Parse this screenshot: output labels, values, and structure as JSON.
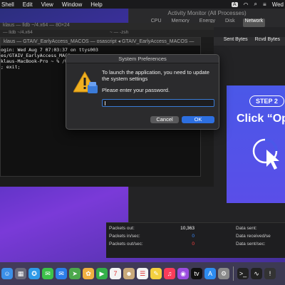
{
  "menubar": {
    "items": [
      "Shell",
      "Edit",
      "View",
      "Window",
      "Help"
    ],
    "right_kbd": "A",
    "clock": "Wed"
  },
  "activity_monitor": {
    "title": "Activity Monitor (All Processes)",
    "tabs": [
      "CPU",
      "Memory",
      "Energy",
      "Disk",
      "Network"
    ],
    "active_tab": "Network",
    "columns": [
      "Sent Bytes",
      "Rcvd Bytes"
    ],
    "stats": {
      "packets_out_label": "Packets out:",
      "packets_out_value": "10,363",
      "packets_in_sec_label": "Packets in/sec:",
      "packets_in_sec_value": "0",
      "packets_out_sec_label": "Packets out/sec:",
      "packets_out_sec_value": "0",
      "data_sent_label": "Data sent:",
      "data_received_label": "Data received/se",
      "data_sent_sec_label": "Data sent/sec:"
    }
  },
  "terminal_back": {
    "title": "klaus — lldb ~/4.x64 — 80×24",
    "tabs": [
      "— lldb ~/4.x64",
      "~ — -zsh"
    ]
  },
  "terminal": {
    "title": "klaus — GTAIV_EarlyAccess_MACOS — osascript ◂ GTAIV_EarlyAccess_MACOS —",
    "lines": [
      "ogin: Wed Aug  7 07:03:37 on ttys003",
      "es/GTAIV_EarlyAccess_MACO",
      "klaus-MacBook-Pro ~ % /U",
      "; exit;"
    ]
  },
  "promo": {
    "step": "STEP 2",
    "click": "Click “Op"
  },
  "dialog": {
    "title": "System Preferences",
    "message": "To launch the application, you need to update the system settings",
    "prompt": "Please enter your password.",
    "password_value": "",
    "cancel_label": "Cancel",
    "ok_label": "OK"
  },
  "dock": {
    "items": [
      {
        "name": "finder-icon",
        "glyph": "☺",
        "color": "#3b8fe8"
      },
      {
        "name": "launchpad-icon",
        "glyph": "▦",
        "color": "#6a6a7a"
      },
      {
        "name": "safari-icon",
        "glyph": "✪",
        "color": "#2e9ae8"
      },
      {
        "name": "messages-icon",
        "glyph": "✉",
        "color": "#3cc24a"
      },
      {
        "name": "mail-icon",
        "glyph": "✉",
        "color": "#2b7de9"
      },
      {
        "name": "maps-icon",
        "glyph": "➤",
        "color": "#4ca84c"
      },
      {
        "name": "photos-icon",
        "glyph": "✿",
        "color": "#f0b040"
      },
      {
        "name": "facetime-icon",
        "glyph": "▶",
        "color": "#34b04a"
      },
      {
        "name": "calendar-icon",
        "glyph": "7",
        "color": "#f4f4f4"
      },
      {
        "name": "contacts-icon",
        "glyph": "☻",
        "color": "#c9a97a"
      },
      {
        "name": "reminders-icon",
        "glyph": "☰",
        "color": "#f4f4f4"
      },
      {
        "name": "notes-icon",
        "glyph": "✎",
        "color": "#f4d040"
      },
      {
        "name": "music-icon",
        "glyph": "♫",
        "color": "#fa3c5a"
      },
      {
        "name": "podcasts-icon",
        "glyph": "◉",
        "color": "#9b4de0"
      },
      {
        "name": "tv-icon",
        "glyph": "tv",
        "color": "#111111"
      },
      {
        "name": "app-store-icon",
        "glyph": "A",
        "color": "#2d8cf0"
      },
      {
        "name": "system-preferences-icon",
        "glyph": "⚙",
        "color": "#8a8a8a"
      },
      {
        "name": "terminal-icon",
        "glyph": ">_",
        "color": "#222222"
      },
      {
        "name": "activity-monitor-icon",
        "glyph": "∿",
        "color": "#222222"
      },
      {
        "name": "warning-doc-icon",
        "glyph": "!",
        "color": "#333333"
      }
    ]
  },
  "colors": {
    "accent": "#2d6fe0",
    "dialog_bg": "#2b2b2d",
    "promo_bg": "#4a58e8"
  }
}
